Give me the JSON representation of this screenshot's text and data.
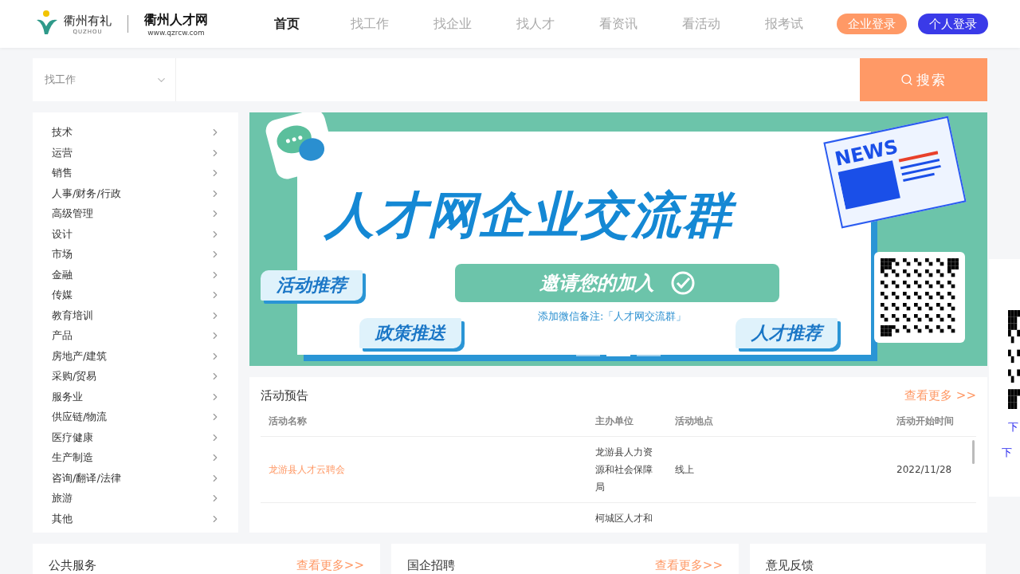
{
  "header": {
    "logo_city": "衢州有礼",
    "logo_city_en": "QUZHOU",
    "site_name": "衢州人才网",
    "site_url": "www.qzrcw.com",
    "nav": [
      {
        "label": "首页",
        "selected": true
      },
      {
        "label": "找工作",
        "selected": false
      },
      {
        "label": "找企业",
        "selected": false
      },
      {
        "label": "找人才",
        "selected": false
      },
      {
        "label": "看资讯",
        "selected": false
      },
      {
        "label": "看活动",
        "selected": false
      },
      {
        "label": "报考试",
        "selected": false
      }
    ],
    "login_buttons": [
      {
        "label": "企业登录",
        "kind": "company"
      },
      {
        "label": "个人登录",
        "kind": "personal"
      }
    ]
  },
  "search": {
    "category": "找工作",
    "button": "搜索"
  },
  "categories": [
    "技术",
    "运营",
    "销售",
    "人事/财务/行政",
    "高级管理",
    "设计",
    "市场",
    "金融",
    "传媒",
    "教育培训",
    "产品",
    "房地产/建筑",
    "采购/贸易",
    "服务业",
    "供应链/物流",
    "医疗健康",
    "生产制造",
    "咨询/翻译/法律",
    "旅游",
    "其他"
  ],
  "banner": {
    "title": "人才网企业交流群",
    "invite": "邀请您的加入",
    "note": "添加微信备注:「人才网交流群」",
    "news": "NEWS",
    "tags": [
      "活动推荐",
      "政策推送",
      "人才推荐"
    ],
    "dots": [
      {
        "selected": false
      },
      {
        "selected": true
      },
      {
        "selected": false
      }
    ]
  },
  "activities": {
    "title": "活动预告",
    "more": "查看更多 >>",
    "columns": [
      "活动名称",
      "主办单位",
      "活动地点",
      "活动开始时间"
    ],
    "rows": [
      {
        "name": "龙游县人才云聘会",
        "organizer": "龙游县人力资源和社会保障局",
        "location": "线上",
        "start": "2022/11/28"
      },
      {
        "organizer": "柯城区人才和"
      }
    ]
  },
  "bottom_cards": [
    {
      "title": "公共服务",
      "more": "查看更多>>"
    },
    {
      "title": "国企招聘",
      "more": "查看更多>>"
    },
    {
      "title": "意见反馈"
    }
  ],
  "side_panel": {
    "links": [
      "下",
      "下"
    ]
  }
}
